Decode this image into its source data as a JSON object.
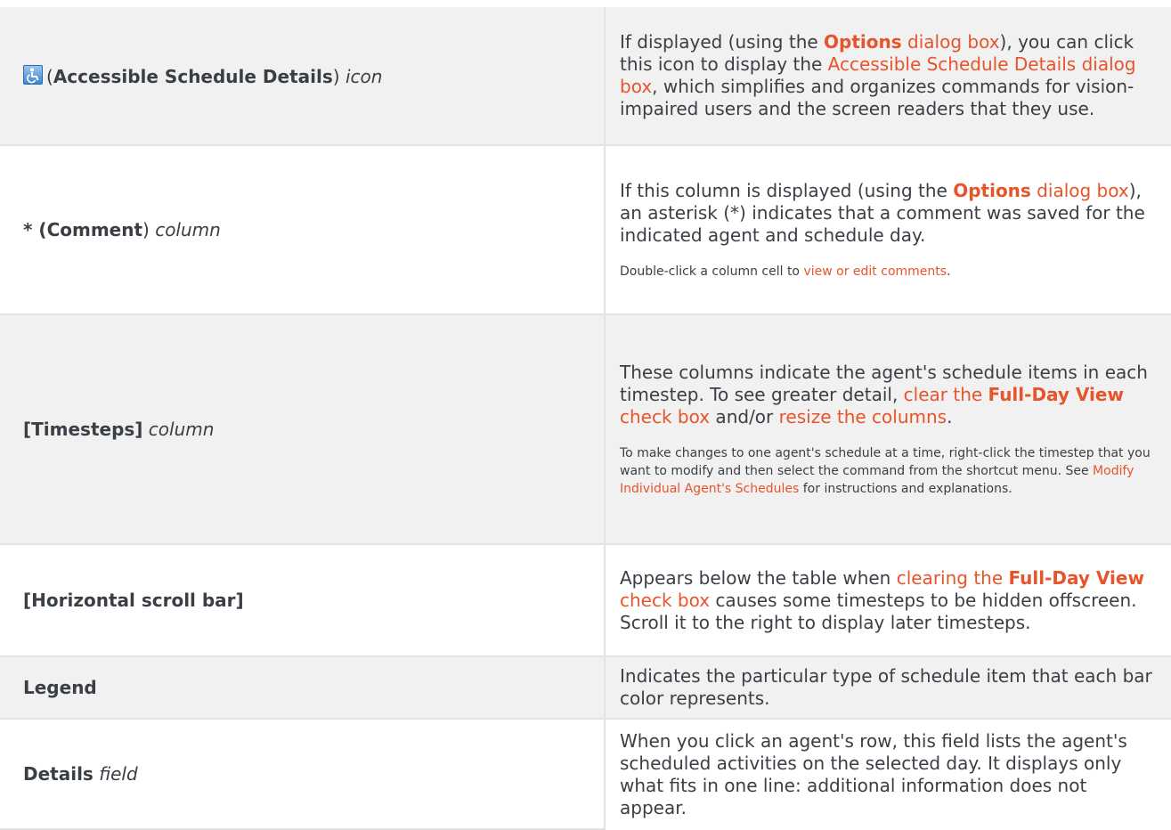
{
  "rows": [
    {
      "left": {
        "prefix": "(",
        "bold": "Accessible Schedule Details",
        "suffix": ")",
        "italic": "icon"
      },
      "right": {
        "t1": "If displayed (using the ",
        "link1_bold": "Options",
        "link1_rest": " dialog box",
        "t2": "), you can click this icon to display the ",
        "link2": "Accessible Schedule Details dialog box",
        "t3": ", which simplifies and organizes commands for vision-impaired users and the screen readers that they use."
      }
    },
    {
      "left": {
        "prefix": "* (",
        "bold": "Comment",
        "suffix": ")",
        "italic": "column"
      },
      "right": {
        "t1": "If this column is displayed (using the ",
        "link1_bold": "Options",
        "link1_rest": " dialog box",
        "t2": "), an asterisk (*) indicates that a comment was saved for the indicated agent and schedule day.",
        "s1": "Double-click a column cell to ",
        "slink": "view or edit comments",
        "s2": "."
      }
    },
    {
      "left": {
        "bold": "[Timesteps]",
        "italic": "column"
      },
      "right": {
        "t1": "These columns indicate the agent's schedule items in each timestep. To see greater detail, ",
        "link1": "clear the ",
        "link1_bold": "Full-Day View",
        "link1_rest": " check box",
        "t2": " and/or ",
        "link2": "resize the columns",
        "t3": ".",
        "s1": "To make changes to one agent's schedule at a time, right-click the timestep that you want to modify and then select the command from the shortcut menu. See ",
        "slink": "Modify Individual Agent's Schedules",
        "s2": " for instructions and explanations."
      }
    },
    {
      "left": {
        "bold": "[Horizontal scroll bar]"
      },
      "right": {
        "t1": "Appears below the table when ",
        "link1": "clearing the ",
        "link1_bold": "Full-Day View",
        "link1_rest": " check box",
        "t2": " causes some timesteps to be hidden offscreen. Scroll it to the right to display later timesteps."
      }
    },
    {
      "left": {
        "bold": "Legend"
      },
      "right": {
        "t1": "Indicates the particular type of schedule item that each bar color represents."
      }
    },
    {
      "left": {
        "bold": "Details",
        "italic": "field"
      },
      "right": {
        "t1": "When you click an agent's row, this field lists the agent's scheduled activities on the selected day. It displays only what fits in one line: additional information does not appear."
      }
    }
  ]
}
